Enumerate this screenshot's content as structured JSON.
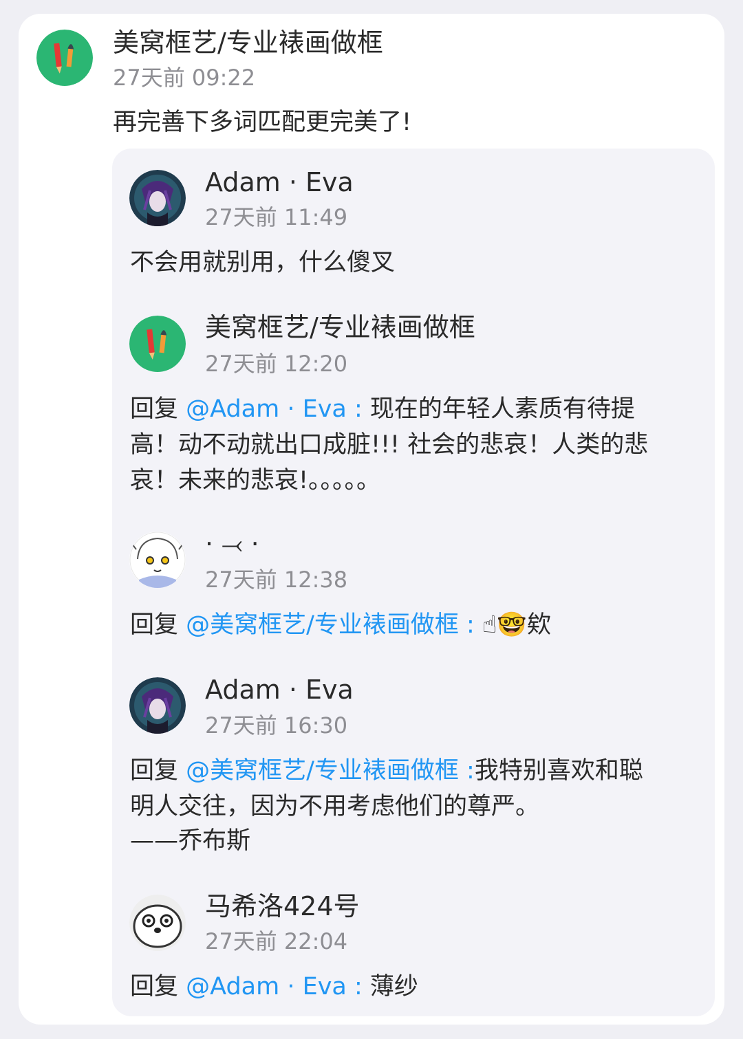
{
  "main_comment": {
    "author": "美窝框艺/专业裱画做框",
    "time": "27天前 09:22",
    "text": "再完善下多词匹配更完美了!"
  },
  "replies": [
    {
      "author": "Adam · Eva",
      "time": "27天前 11:49",
      "text": "不会用就别用，什么傻叉"
    },
    {
      "author": "美窝框艺/专业裱画做框",
      "time": "27天前 12:20",
      "reply_prefix": "回复 ",
      "mention": "@Adam · Eva :",
      "text_line1": " 现在的年轻人素质有待提",
      "text_line2": "高！动不动就出口成脏!!! 社会的悲哀！人类的悲",
      "text_line3": "哀！未来的悲哀!。。。。。"
    },
    {
      "author": "· ⤙ ·",
      "time": "27天前 12:38",
      "reply_prefix": "回复 ",
      "mention": "@美窝框艺/专业裱画做框 :",
      "text": " ☝🤓欸"
    },
    {
      "author": "Adam · Eva",
      "time": "27天前 16:30",
      "reply_prefix": "回复 ",
      "mention": "@美窝框艺/专业裱画做框 :",
      "text_line1": "我特别喜欢和聪",
      "text_line2": "明人交往，因为不用考虑他们的尊严。",
      "text_line3": "——乔布斯"
    },
    {
      "author": "马希洛424号",
      "time": "27天前 22:04",
      "reply_prefix": "回复 ",
      "mention": "@Adam · Eva :",
      "text": " 薄纱"
    }
  ],
  "colors": {
    "mention": "#2196f3",
    "time": "#8e8e93",
    "reply_bg": "#f3f3f8",
    "avatar_green": "#2bb673"
  },
  "icons": {
    "shop_avatar": "pencil-brush-avatar",
    "adam_avatar": "anime-character-avatar",
    "dot_avatar": "doodle-girl-avatar",
    "marshmallow_avatar": "seal-face-avatar"
  }
}
